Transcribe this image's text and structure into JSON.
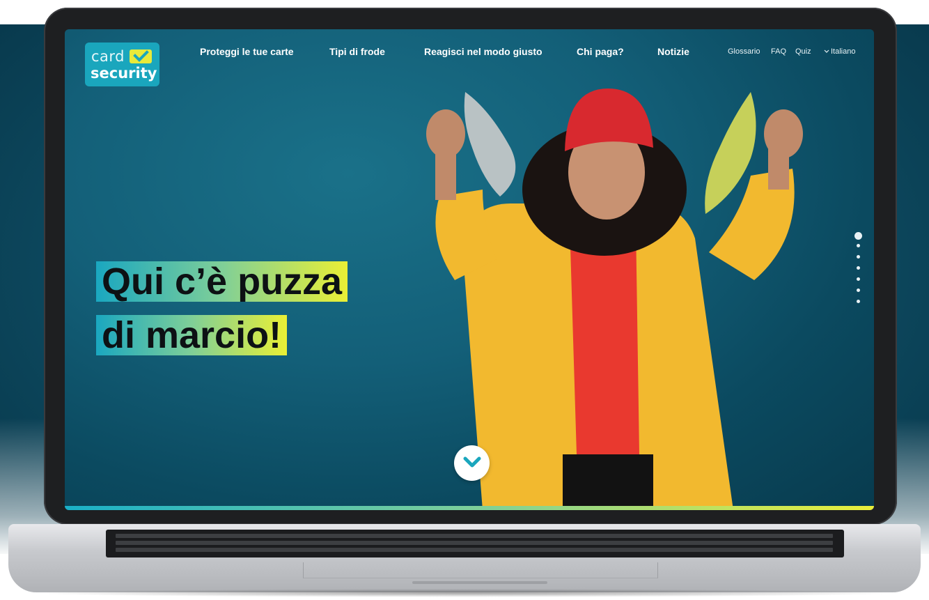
{
  "logo": {
    "line1": "card",
    "line2": "security"
  },
  "nav": {
    "items": [
      {
        "label": "Proteggi le tue carte"
      },
      {
        "label": "Tipi di frode"
      },
      {
        "label": "Reagisci nel modo giusto"
      },
      {
        "label": "Chi paga?"
      },
      {
        "label": "Notizie"
      }
    ],
    "utility": [
      {
        "label": "Glossario"
      },
      {
        "label": "FAQ"
      },
      {
        "label": "Quiz"
      }
    ],
    "language": "Italiano"
  },
  "hero": {
    "headline_line1": "Qui c’è puzza",
    "headline_line2": "di marcio!"
  },
  "pager": {
    "count": 7,
    "active_index": 0
  },
  "colors": {
    "brand_teal": "#1aa6bd",
    "brand_yellow": "#e8ea3a",
    "hero_background": "#135f78"
  },
  "icons": {
    "logo_check": "checkmark-icon",
    "scroll_down": "chevron-down-icon",
    "language": "chevron-down-icon"
  }
}
